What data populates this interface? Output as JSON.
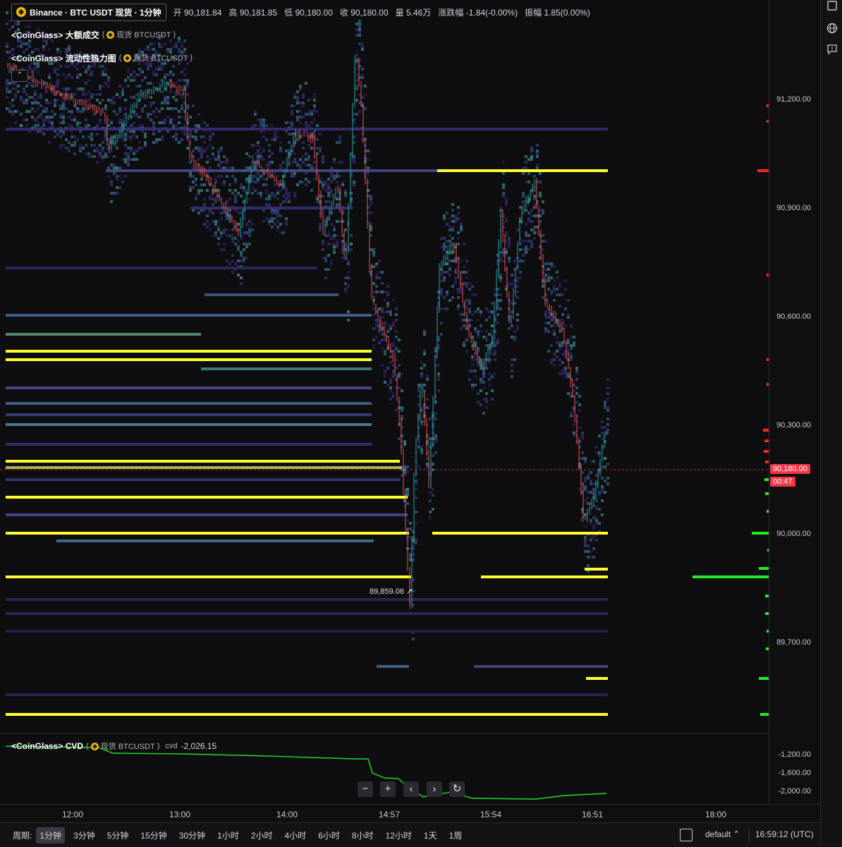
{
  "header": {
    "symbol_title": "Binance · BTC USDT 现货 · 1分钟",
    "ohlc": [
      {
        "label": "开",
        "value": "90,181.84"
      },
      {
        "label": "高",
        "value": "90,181.85"
      },
      {
        "label": "低",
        "value": "90,180.00"
      },
      {
        "label": "收",
        "value": "90,180.00"
      },
      {
        "label": "量",
        "value": "5.46万"
      },
      {
        "label": "涨跌幅",
        "value": "-1.84(-0.00%)"
      },
      {
        "label": "振幅",
        "value": "1.85(0.00%)"
      }
    ]
  },
  "indicators": {
    "large_trades": {
      "name": "<CoinGlass> 大额成交",
      "source": "现货 BTCUSDT"
    },
    "heatmap": {
      "name": "<CoinGlass> 流动性热力图",
      "source": "现货 BTCUSDT"
    },
    "collapse_icon": "chevron-up-icon"
  },
  "price_axis": {
    "labels": [
      "91,200.00",
      "90,900.00",
      "90,600.00",
      "90,300.00",
      "90,000.00",
      "89,700.00"
    ],
    "current_price": "90,180.00",
    "countdown": "00:47",
    "low_marker": "89,859.06"
  },
  "cvd": {
    "name": "<CoinGlass> CVD",
    "source": "现货 BTCUSDT",
    "value_label": "cvd",
    "value": "-2,026.15",
    "axis_labels": [
      "-1,200.00",
      "-1,600.00",
      "-2,000.00"
    ]
  },
  "zoom_controls": {
    "zoom_out": "−",
    "zoom_in": "+",
    "prev": "‹",
    "next": "›",
    "reset": "↻"
  },
  "time_axis": [
    "12:00",
    "13:00",
    "14:00",
    "14:57",
    "15:54",
    "16:51",
    "18:00"
  ],
  "bottom_bar": {
    "period_label": "周期:",
    "periods": [
      "1分钟",
      "3分钟",
      "5分钟",
      "15分钟",
      "30分钟",
      "1小时",
      "2小时",
      "4小时",
      "6小时",
      "8小时",
      "12小时",
      "1天",
      "1周"
    ],
    "active_period": "1分钟",
    "layout": "default",
    "clock": "16:59:12 (UTC)"
  },
  "right_toolbar": [
    "square-icon",
    "globe-icon",
    "comment-icon"
  ],
  "colors": {
    "up": "#26a69a",
    "down": "#ef5350",
    "liquidity_high": "#ffff33",
    "bid_bar": "#22ee22",
    "ask_bar": "#ff2222",
    "cvd_line": "#22dd22"
  }
}
